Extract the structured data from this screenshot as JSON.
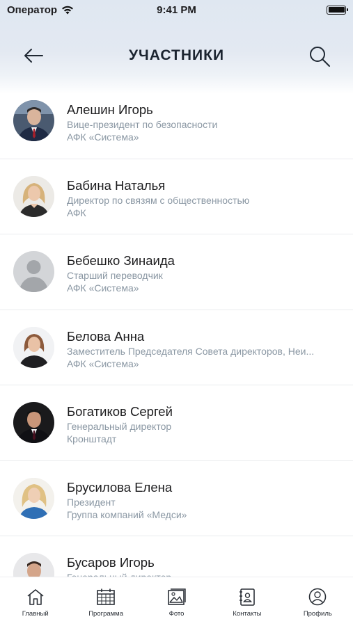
{
  "status_bar": {
    "carrier": "Оператор",
    "time": "9:41 PM"
  },
  "nav": {
    "title": "УЧАСТНИКИ",
    "back_icon": "arrow-left-icon",
    "search_icon": "search-icon"
  },
  "participants": [
    {
      "name": "Алешин Игорь",
      "position": "Вице-президент по безопасности",
      "company": "АФК «Система»",
      "avatar": "photo"
    },
    {
      "name": "Бабина Наталья",
      "position": "Директор по связям с общественностью",
      "company": "АФК",
      "avatar": "photo"
    },
    {
      "name": "Бебешко  Зинаида",
      "position": "Старший переводчик",
      "company": "АФК «Система»",
      "avatar": "placeholder"
    },
    {
      "name": "Белова Анна",
      "position": "Заместитель Председателя Совета директоров, Неи...",
      "company": "АФК «Система»",
      "avatar": "photo"
    },
    {
      "name": "Богатиков Сергей",
      "position": "Генеральный директор",
      "company": "Кронштадт",
      "avatar": "photo"
    },
    {
      "name": "Брусилова Елена",
      "position": "Президент",
      "company": "Группа компаний «Медси»",
      "avatar": "photo"
    },
    {
      "name": "Бусаров Игорь",
      "position": "Генеральный директор",
      "company": "",
      "avatar": "photo"
    }
  ],
  "tabs": [
    {
      "label": "Главный",
      "icon": "home-icon"
    },
    {
      "label": "Программа",
      "icon": "calendar-icon"
    },
    {
      "label": "Фото",
      "icon": "photo-icon"
    },
    {
      "label": "Контакты",
      "icon": "contacts-icon"
    },
    {
      "label": "Профиль",
      "icon": "profile-icon"
    }
  ]
}
